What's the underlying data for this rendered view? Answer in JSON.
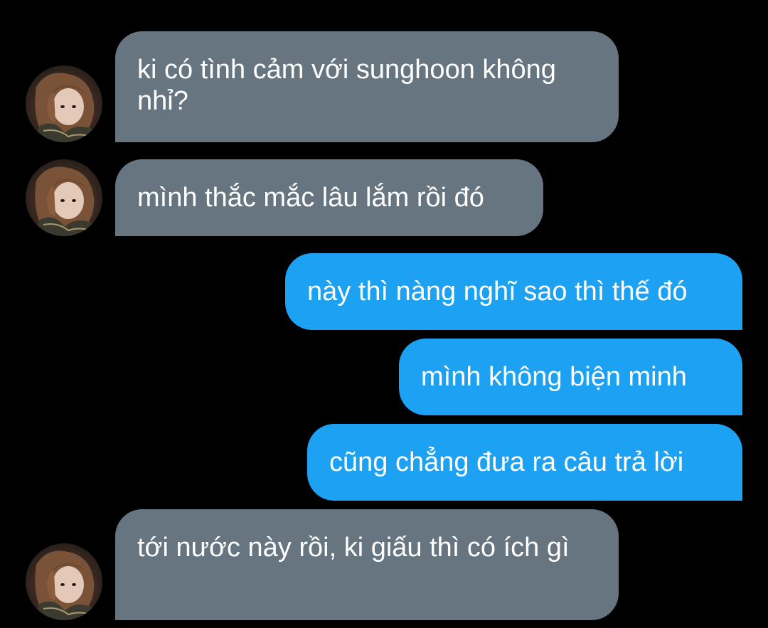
{
  "conversation": {
    "messages": [
      {
        "side": "received",
        "text": "ki có tình cảm với sunghoon không nhỉ?"
      },
      {
        "side": "received",
        "text": "mình thắc mắc lâu lắm rồi đó"
      },
      {
        "side": "sent",
        "text": "này thì nàng nghĩ sao thì thế đó"
      },
      {
        "side": "sent",
        "text": "mình không biện minh"
      },
      {
        "side": "sent",
        "text": "cũng chẳng đưa ra câu trả lời"
      },
      {
        "side": "received",
        "text": "tới nước này rồi, ki giấu thì có ích gì"
      }
    ]
  },
  "colors": {
    "background": "#000000",
    "received_bubble": "#66757f",
    "sent_bubble": "#1da1f2",
    "text": "#ffffff"
  },
  "icons": {
    "avatar": "user-avatar-photo"
  }
}
